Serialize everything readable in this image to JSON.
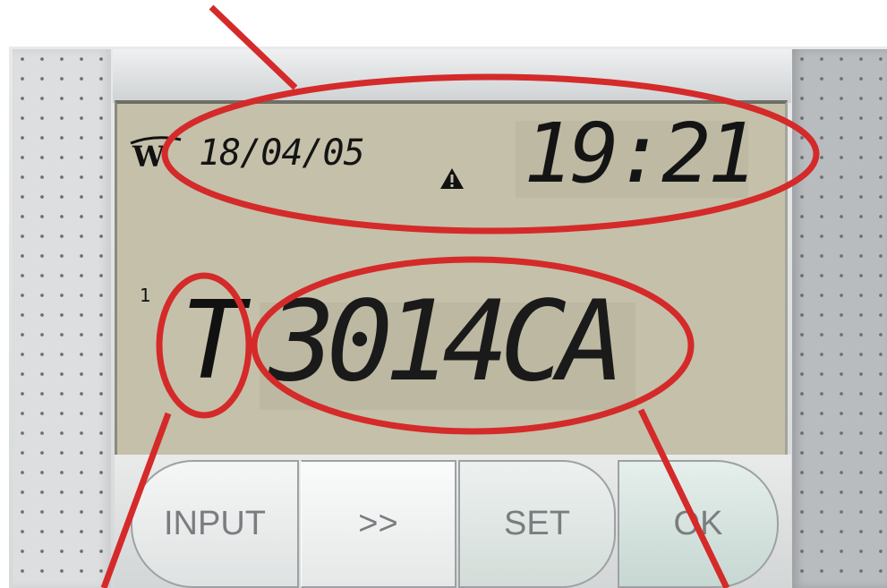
{
  "display": {
    "date": "18/04/05",
    "time": "19:21",
    "line_number": "1",
    "type_flag": "T",
    "code": "3014CA"
  },
  "buttons": {
    "input": "INPUT",
    "next": ">>",
    "set": "SET",
    "ok": "OK"
  },
  "colors": {
    "lcd_background": "#c5c0aa",
    "lcd_text": "#141414",
    "annotation": "#d42a2a",
    "button_text": "#7a7d80"
  },
  "icons": [
    "w-logo-icon",
    "warning-icon"
  ]
}
